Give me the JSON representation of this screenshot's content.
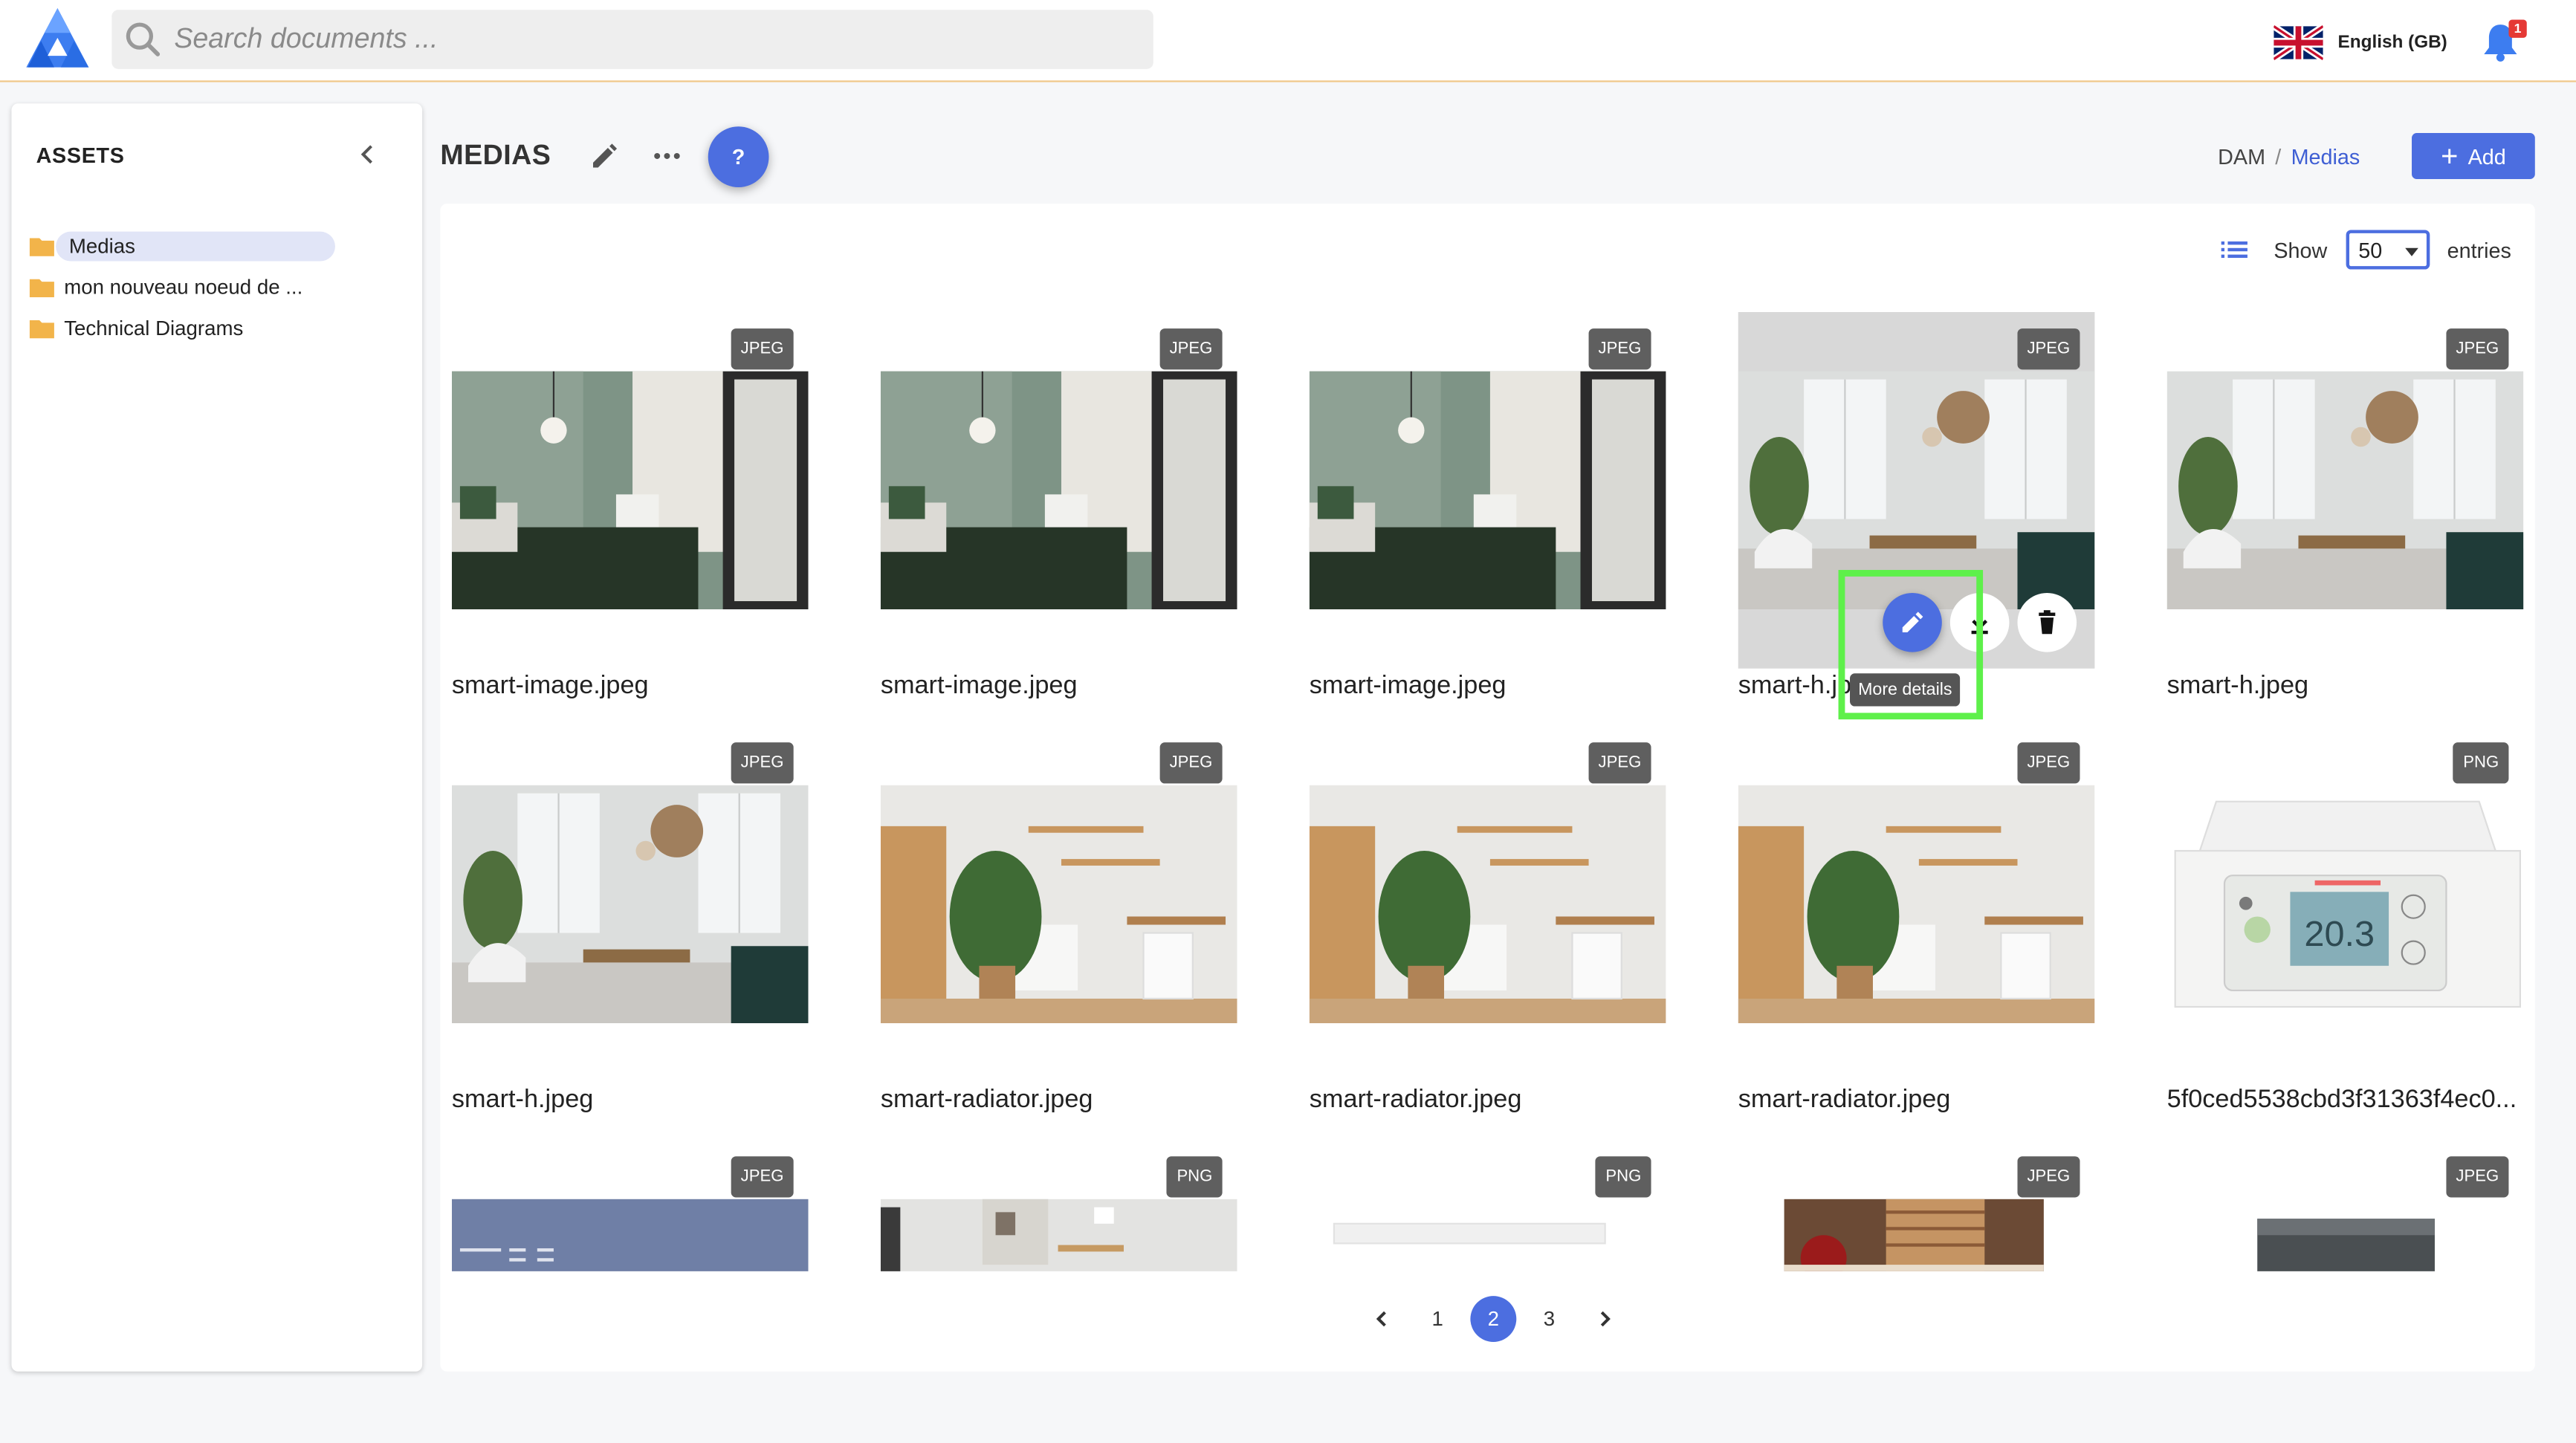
{
  "header": {
    "search_placeholder": "Search documents ...",
    "language": "English (GB)",
    "notifications_count": "1"
  },
  "sidebar": {
    "title": "ASSETS",
    "items": [
      {
        "label": "Medias",
        "active": true
      },
      {
        "label": "mon nouveau noeud de ..."
      },
      {
        "label": "Technical Diagrams"
      }
    ]
  },
  "main": {
    "title": "MEDIAS",
    "help_label": "?",
    "breadcrumb": {
      "root": "DAM",
      "separator": "/",
      "current": "Medias"
    },
    "add_label": "Add",
    "show_label": "Show",
    "entries_value": "50",
    "entries_label": "entries"
  },
  "assets": [
    {
      "name": "smart-image.jpeg",
      "type": "JPEG",
      "thumb": "bedroom"
    },
    {
      "name": "smart-image.jpeg",
      "type": "JPEG",
      "thumb": "bedroom"
    },
    {
      "name": "smart-image.jpeg",
      "type": "JPEG",
      "thumb": "bedroom"
    },
    {
      "name": "smart-h.jpeg",
      "type": "JPEG",
      "thumb": "living",
      "hovered": true
    },
    {
      "name": "smart-h.jpeg",
      "type": "JPEG",
      "thumb": "living"
    },
    {
      "name": "smart-h.jpeg",
      "type": "JPEG",
      "thumb": "living"
    },
    {
      "name": "smart-radiator.jpeg",
      "type": "JPEG",
      "thumb": "radiator"
    },
    {
      "name": "smart-radiator.jpeg",
      "type": "JPEG",
      "thumb": "radiator"
    },
    {
      "name": "smart-radiator.jpeg",
      "type": "JPEG",
      "thumb": "radiator"
    },
    {
      "name": "5f0ced5538cbd3f31363f4ec0...",
      "type": "PNG",
      "thumb": "thermostat"
    },
    {
      "name": "",
      "type": "JPEG",
      "thumb": "blue"
    },
    {
      "name": "",
      "type": "PNG",
      "thumb": "shelf"
    },
    {
      "name": "",
      "type": "PNG",
      "thumb": "white"
    },
    {
      "name": "",
      "type": "JPEG",
      "thumb": "window"
    },
    {
      "name": "",
      "type": "JPEG",
      "thumb": "dark"
    }
  ],
  "hover_tooltip": "More details",
  "pagination": {
    "pages": [
      "1",
      "2",
      "3"
    ],
    "current": "2"
  }
}
